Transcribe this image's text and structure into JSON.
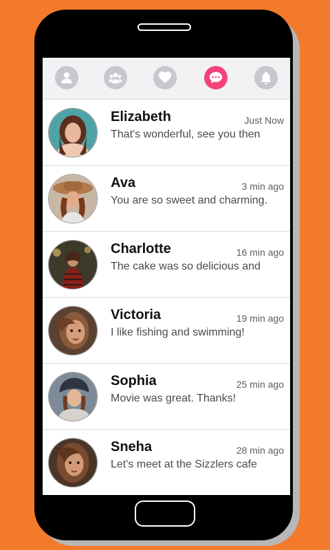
{
  "colors": {
    "background": "#f47a2b",
    "accent": "#f4437b",
    "tab_inactive": "#c6c7cf"
  },
  "tabs": [
    {
      "icon": "person-icon",
      "active": false
    },
    {
      "icon": "group-icon",
      "active": false
    },
    {
      "icon": "heart-icon",
      "active": false
    },
    {
      "icon": "chat-bubble-icon",
      "active": true
    },
    {
      "icon": "bell-icon",
      "active": false
    }
  ],
  "conversations": [
    {
      "name": "Elizabeth",
      "time": "Just Now",
      "message": "That's wonderful, see you then"
    },
    {
      "name": "Ava",
      "time": "3 min ago",
      "message": "You are so sweet and charming."
    },
    {
      "name": "Charlotte",
      "time": "16 min ago",
      "message": "The cake was so delicious and"
    },
    {
      "name": "Victoria",
      "time": "19 min ago",
      "message": "I like fishing and swimming!"
    },
    {
      "name": "Sophia",
      "time": "25 min ago",
      "message": "Movie was great. Thanks!"
    },
    {
      "name": "Sneha",
      "time": "28 min ago",
      "message": "Let's meet at the Sizzlers cafe"
    }
  ]
}
